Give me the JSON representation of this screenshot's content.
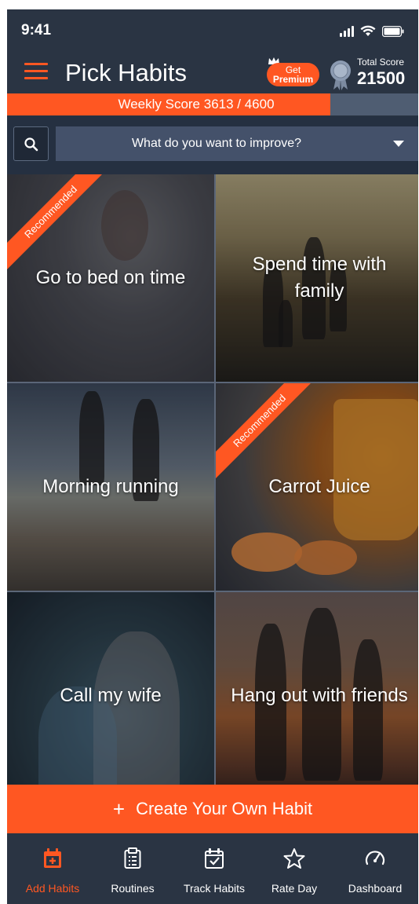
{
  "status_bar": {
    "time": "9:41"
  },
  "header": {
    "title": "Pick Habits",
    "premium_line1": "Get",
    "premium_line2": "Premium",
    "total_score_label": "Total Score",
    "total_score_value": "21500"
  },
  "weekly_score": {
    "text": "Weekly Score  3613 / 4600",
    "current": 3613,
    "max": 4600
  },
  "search": {
    "dropdown_text": "What do you want to improve?"
  },
  "habits": [
    {
      "label": "Go to bed on time",
      "recommended": true
    },
    {
      "label": "Spend time with family",
      "recommended": false
    },
    {
      "label": "Morning running",
      "recommended": false
    },
    {
      "label": "Carrot Juice",
      "recommended": true
    },
    {
      "label": "Call my wife",
      "recommended": false
    },
    {
      "label": "Hang out with friends",
      "recommended": false
    }
  ],
  "ribbon_text": "Recommended",
  "create_button": {
    "label": "Create Your Own Habit"
  },
  "tabs": [
    {
      "label": "Add Habits",
      "icon": "calendar-plus-icon",
      "active": true
    },
    {
      "label": "Routines",
      "icon": "clipboard-icon",
      "active": false
    },
    {
      "label": "Track Habits",
      "icon": "calendar-check-icon",
      "active": false
    },
    {
      "label": "Rate Day",
      "icon": "star-icon",
      "active": false
    },
    {
      "label": "Dashboard",
      "icon": "speedometer-icon",
      "active": false
    }
  ],
  "colors": {
    "accent": "#ff5722",
    "background": "#2a3443",
    "search_field": "#44516a"
  }
}
